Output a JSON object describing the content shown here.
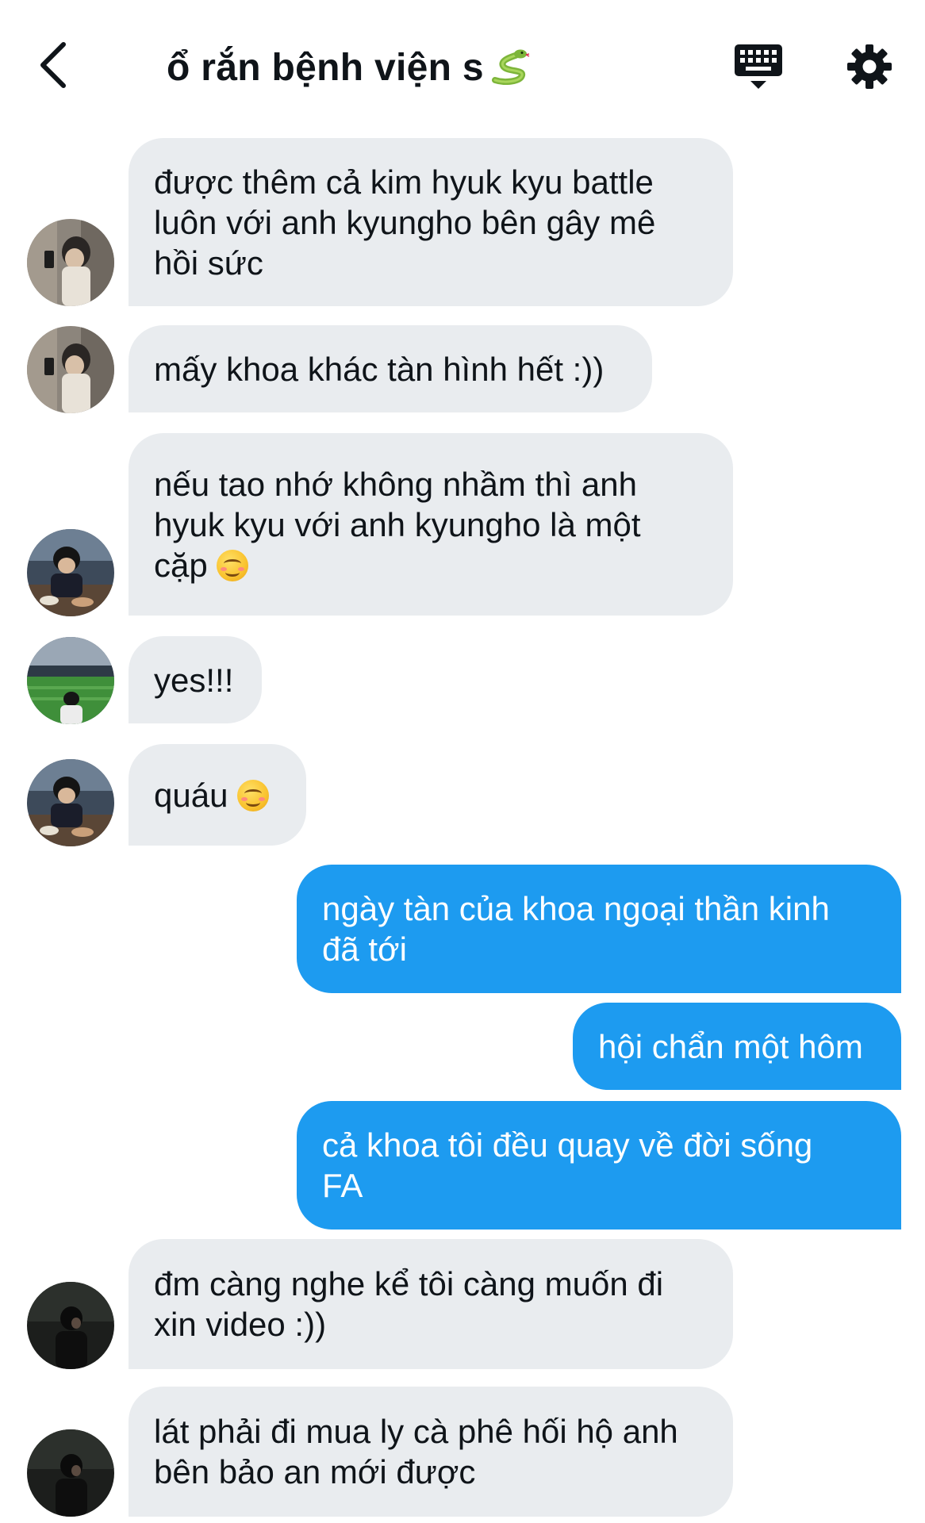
{
  "header": {
    "title": "ổ rắn bệnh viện s",
    "title_emoji": "snake-icon"
  },
  "messages": [
    {
      "side": "in",
      "text": "được thêm cả kim hyuk kyu battle\nluôn với anh kyungho bên gây mê\nhồi sức",
      "emoji": "",
      "avatar": "avatar-a"
    },
    {
      "side": "in",
      "text": "mấy khoa khác tàn hình hết :))",
      "emoji": "",
      "avatar": "avatar-a"
    },
    {
      "side": "in",
      "text": "nếu tao nhớ không nhầm thì anh\nhyuk kyu với anh kyungho là một\ncặp ",
      "emoji": "smiling-face-icon",
      "avatar": "avatar-b"
    },
    {
      "side": "in",
      "text": "yes!!!",
      "emoji": "",
      "avatar": "avatar-c"
    },
    {
      "side": "in",
      "text": "quáu ",
      "emoji": "smiling-face-icon",
      "avatar": "avatar-b"
    },
    {
      "side": "out",
      "text": "ngày tàn của khoa ngoại thần kinh\nđã tới",
      "emoji": ""
    },
    {
      "side": "out",
      "text": "hội chẩn một hôm",
      "emoji": ""
    },
    {
      "side": "out",
      "text": "cả khoa tôi đều quay về đời sống\nFA",
      "emoji": ""
    },
    {
      "side": "in",
      "text": "đm càng nghe kể tôi càng muốn đi\nxin video :))",
      "emoji": "",
      "avatar": "avatar-d"
    },
    {
      "side": "in",
      "text": "lát phải đi mua ly cà phê hối hộ anh\nbên bảo an mới được",
      "emoji": "",
      "avatar": "avatar-d"
    }
  ],
  "colors": {
    "incoming_bubble": "#e9ecef",
    "outgoing_bubble": "#1d9bf0",
    "text": "#0f1419"
  }
}
